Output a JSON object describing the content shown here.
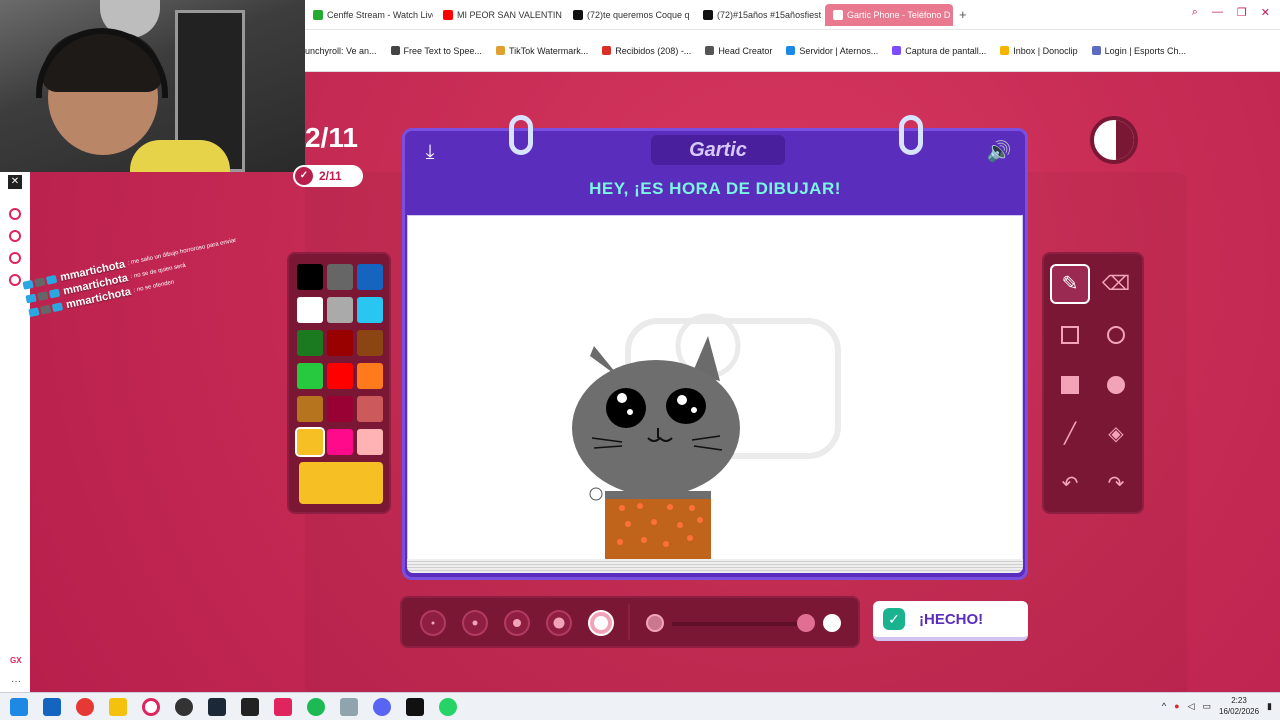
{
  "browser": {
    "tabs": [
      {
        "label": "Cenffe Stream - Watch Live",
        "color": "#22aa33"
      },
      {
        "label": "MI PEOR SAN VALENTIN",
        "color": "#ff0000"
      },
      {
        "label": "(72)te queremos Coque q",
        "color": "#111111"
      },
      {
        "label": "(72)#15años #15añosfiest",
        "color": "#111111"
      },
      {
        "label": "Gartic Phone - Teléfono D",
        "color": "#e0245e",
        "active": true
      }
    ],
    "new_tab": "+",
    "bookmarks": [
      {
        "label": "unchyroll: Ve an...",
        "color": "#f47521"
      },
      {
        "label": "Free Text to Spee...",
        "color": "#444444"
      },
      {
        "label": "TikTok Watermark...",
        "color": "#e0a030"
      },
      {
        "label": "Recibidos (208) -...",
        "color": "#d93025"
      },
      {
        "label": "Head Creator",
        "color": "#555555"
      },
      {
        "label": "Servidor | Aternos...",
        "color": "#1e88e5"
      },
      {
        "label": "Captura de pantall...",
        "color": "#7c4dff"
      },
      {
        "label": "Inbox | Donoclip",
        "color": "#f4b400"
      },
      {
        "label": "Login | Esports Ch...",
        "color": "#5c6bc0"
      }
    ]
  },
  "game": {
    "round_big": "2/11",
    "round_pill": "2/11",
    "logo": "Gartic",
    "prompt": "HEY, ¡ES HORA DE DIBUJAR!",
    "done_label": "¡HECHO!",
    "timer_remaining": 0.55,
    "palette": [
      "#000000",
      "#666666",
      "#1565c0",
      "#ffffff",
      "#aaaaaa",
      "#29c6f2",
      "#1b7a1f",
      "#990000",
      "#8a4513",
      "#27c93f",
      "#ff0000",
      "#ff7a1a",
      "#b5741d",
      "#990033",
      "#cc5a5a",
      "#f6c025",
      "#ff0a8a",
      "#ffb3b3"
    ],
    "selected_color": "#f6c025",
    "brush_sizes_selected": 5
  },
  "chat": [
    {
      "user": "mmartichota",
      "msg": ": me salio un dibujo horroroso para enviar"
    },
    {
      "user": "mmartichota",
      "msg": ": no se de quien será"
    },
    {
      "user": "mmartichota",
      "msg": ": no se ofenden"
    }
  ],
  "taskbar": {
    "time": "2:23",
    "date": "16/02/2026"
  }
}
